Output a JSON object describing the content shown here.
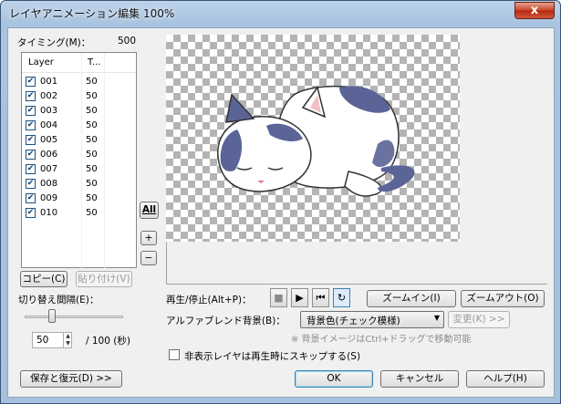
{
  "window": {
    "title": "レイヤアニメーション編集 100%",
    "close_label": "x"
  },
  "timing": {
    "label": "タイミング(M)：",
    "value": "500"
  },
  "layer_list": {
    "columns": [
      "Layer",
      "T..."
    ],
    "rows": [
      {
        "layer": "001",
        "t": "50",
        "checked": true
      },
      {
        "layer": "002",
        "t": "50",
        "checked": true
      },
      {
        "layer": "003",
        "t": "50",
        "checked": true
      },
      {
        "layer": "004",
        "t": "50",
        "checked": true
      },
      {
        "layer": "005",
        "t": "50",
        "checked": true
      },
      {
        "layer": "006",
        "t": "50",
        "checked": true
      },
      {
        "layer": "007",
        "t": "50",
        "checked": true
      },
      {
        "layer": "008",
        "t": "50",
        "checked": true
      },
      {
        "layer": "009",
        "t": "50",
        "checked": true
      },
      {
        "layer": "010",
        "t": "50",
        "checked": true
      }
    ]
  },
  "side_buttons": {
    "all": "All",
    "plus": "+",
    "minus": "−"
  },
  "copy_button": "コピー(C)",
  "paste_button": "貼り付け(V)",
  "interval": {
    "label": "切り替え間隔(E)：",
    "value": "50",
    "suffix": "/ 100 (秒)",
    "slider_level": 0.28
  },
  "playback": {
    "label": "再生/停止(Alt+P)：",
    "stop_icon": "stop-icon",
    "play_icon": "play-icon",
    "rewind_icon": "rewind-icon",
    "loop_icon": "loop-icon"
  },
  "zoom_in": "ズームイン(I)",
  "zoom_out": "ズームアウト(O)",
  "alpha_blend": {
    "label": "アルファブレンド背景(B)：",
    "selected": "背景色(チェック模様)",
    "change_button": "変更(K) >>"
  },
  "hint": "※ 背景イメージはCtrl+ドラッグで移動可能",
  "skip_hidden": {
    "label": "非表示レイヤは再生時にスキップする(S)",
    "checked": false
  },
  "buttons": {
    "save_restore": "保存と復元(D) >>",
    "ok": "OK",
    "cancel": "キャンセル",
    "help": "ヘルプ(H)"
  },
  "colors": {
    "checker_dark": "#b4b4b4",
    "checker_light": "#ffffff",
    "cat_spots": "#5a6496",
    "accent": "#3c7fb1"
  }
}
